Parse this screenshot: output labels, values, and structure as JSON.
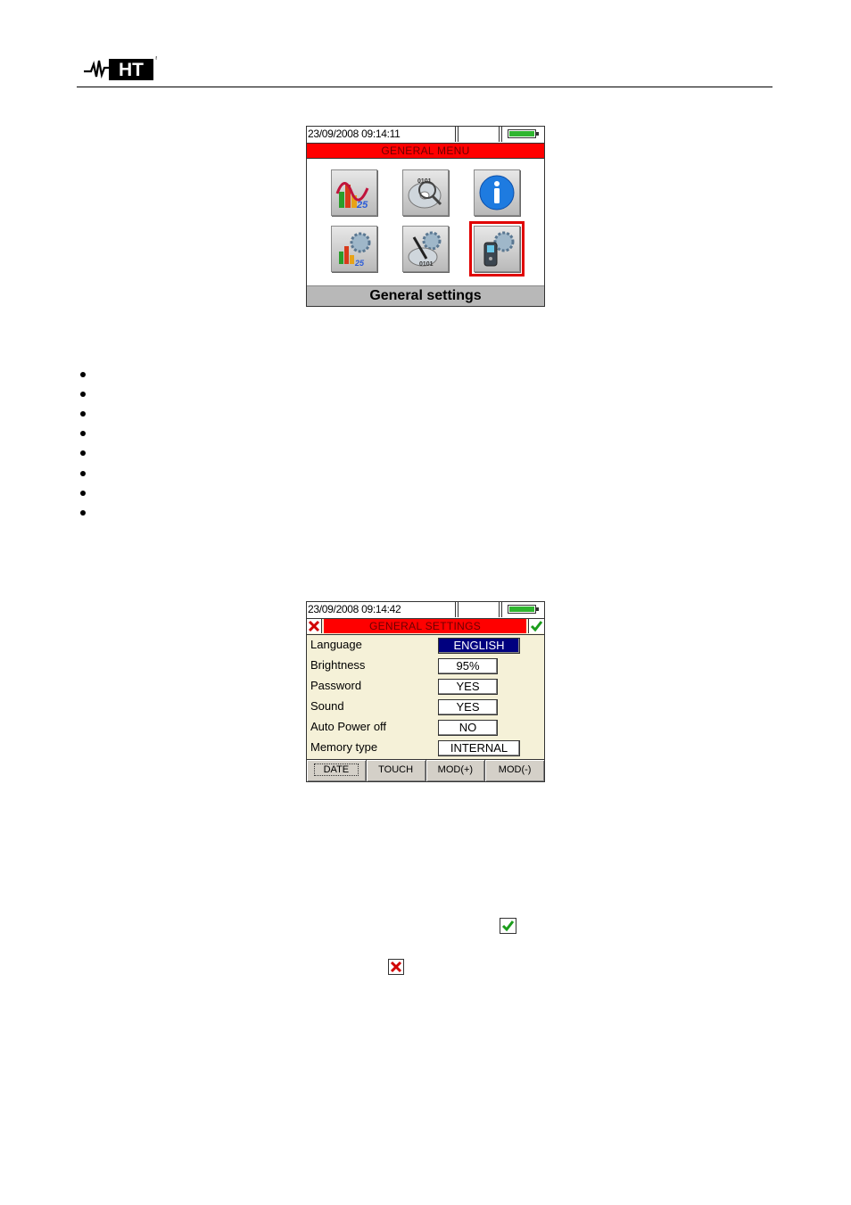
{
  "header": {
    "logo_text": "HT"
  },
  "general_menu": {
    "datetime": "23/09/2008 09:14:11",
    "title": "GENERAL MENU",
    "icons": [
      "analyzer-settings-icon",
      "recording-view-icon",
      "info-icon",
      "analyzer-config-icon",
      "recording-config-icon",
      "general-settings-icon"
    ],
    "selected_label": "General settings"
  },
  "general_settings": {
    "datetime": "23/09/2008 09:14:42",
    "title": "GENERAL SETTINGS",
    "rows": [
      {
        "label": "Language",
        "value": "ENGLISH"
      },
      {
        "label": "Brightness",
        "value": "95%"
      },
      {
        "label": "Password",
        "value": "YES"
      },
      {
        "label": "Sound",
        "value": "YES"
      },
      {
        "label": "Auto Power off",
        "value": "NO"
      },
      {
        "label": "Memory type",
        "value": "INTERNAL"
      }
    ],
    "softkeys": [
      "DATE",
      "TOUCH",
      "MOD(+)",
      "MOD(-)"
    ]
  },
  "colors": {
    "title_red": "#ff0000",
    "highlight_navy": "#00007f",
    "battery_green": "#2fb52f",
    "screen_bg": "#f5f1d8"
  }
}
